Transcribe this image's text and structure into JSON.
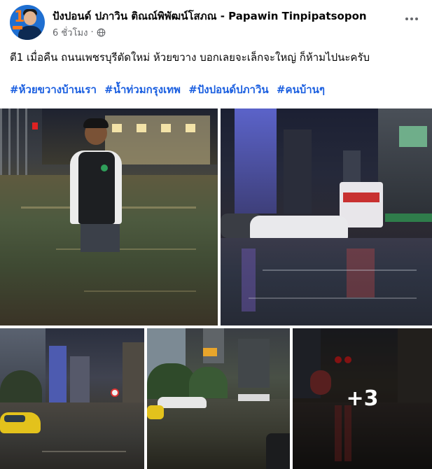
{
  "post": {
    "author": "ปังปอนด์ ปภาวิน ติณณ์พิพัฒน์โสภณ - Papawin Tinpipatsopon",
    "time": "6 ชั่วโมง",
    "separator": "·",
    "privacy_icon": "globe-icon",
    "more_icon": "more-options-icon",
    "avatar_number": "1",
    "body_text": "ตี1 เมื่อคืน ถนนเพชรบุรีตัดใหม่ ห้วยขวาง บอกเลยจะเล็กจะใหญ่ ก็ห้ามไปนะครับ",
    "hashtags": [
      "#ห้วยขวางบ้านเรา",
      "#น้ำท่วมกรุงเทพ",
      "#ปังปอนด์ปภาวิน",
      "#คนบ้านๆ"
    ],
    "more_photos": "+3"
  },
  "colors": {
    "link": "#1b5fe0",
    "secondary_text": "#65676b",
    "avatar_bg": "#1f6fd1",
    "avatar_accent": "#ff7a1a"
  }
}
